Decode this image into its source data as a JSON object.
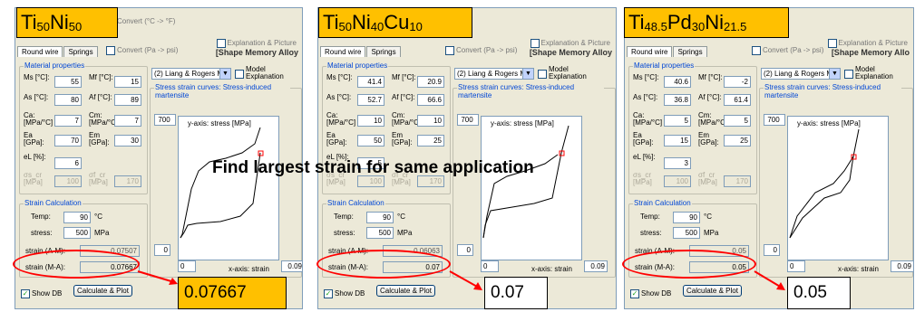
{
  "overlay_text": "Find largest strain for same application",
  "panels": [
    {
      "title_base": "Ti",
      "title_parts": [
        [
          "Ti",
          "50"
        ],
        [
          "Ni",
          "50"
        ]
      ],
      "convert1": "Convert (°C -> °F)",
      "convert2": "Convert (Pa -> psi)",
      "explain1": "Explanation & Picture",
      "explain2": "[Shape Memory Alloy",
      "tab_round": "Round wire",
      "tab_springs": "Springs",
      "mat_label": "Material properties",
      "ms_label": "Ms [°C]:",
      "ms": "55",
      "mf_label": "Mf [°C]:",
      "mf": "15",
      "as_label": "As [°C]:",
      "as": "80",
      "af_label": "Af [°C]:",
      "af": "89",
      "ca_label": "Ca:\n[MPa/°C]",
      "ca": "7",
      "cm_label": "Cm:\n[MPa/°C]",
      "cm": "7",
      "ea_label": "Ea\n[GPa]:",
      "ea": "70",
      "em_label": "Em\n[GPa]:",
      "em": "30",
      "el_label": "eL [%]:",
      "el": "6",
      "csa_label": "σs_cr\n[MPa]",
      "csa": "100",
      "cfa_label": "σf_cr\n[MPa]",
      "cfa": "170",
      "model": "(2) Liang & Rogers Mo",
      "model_expl": "Model\nExplanation",
      "curve_label": "Stress strain curves: Stress-induced martensite",
      "ymax": "700",
      "ylabel": "y-axis: stress [MPa]",
      "ymin": "0",
      "xmin": "0",
      "xmax": "0.09",
      "xlabel": "x-axis: strain",
      "strain_calc": "Strain Calculation",
      "temp_label": "Temp:",
      "temp": "90",
      "temp_unit": "°C",
      "stress_label": "stress:",
      "stress": "500",
      "stress_unit": "MPa",
      "am_label": "strain (A-M):",
      "am": "0.07507",
      "ma_label": "strain (M-A):",
      "ma": "0.07667",
      "showdb": "Show DB",
      "calc": "Calculate & Plot",
      "result": "0.07667"
    },
    {
      "title_parts": [
        [
          "Ti",
          "50"
        ],
        [
          "Ni",
          "40"
        ],
        [
          "Cu",
          "10"
        ]
      ],
      "convert2": "Convert (Pa -> psi)",
      "explain1": "Explanation & Picture",
      "explain2": "[Shape Memory Alloy",
      "tab_round": "Round wire",
      "tab_springs": "Springs",
      "mat_label": "Material properties",
      "ms_label": "Ms [°C]:",
      "ms": "41.4",
      "mf_label": "Mf [°C]:",
      "mf": "20.9",
      "as_label": "As [°C]:",
      "as": "52.7",
      "af_label": "Af [°C]:",
      "af": "66.6",
      "ca_label": "Ca:\n[MPa/°C]",
      "ca": "10",
      "cm_label": "Cm:\n[MPa/°C]",
      "cm": "10",
      "ea_label": "Ea\n[GPa]:",
      "ea": "50",
      "em_label": "Em\n[GPa]:",
      "em": "25",
      "el_label": "eL [%]:",
      "el": "5",
      "csa_label": "σs_cr\n[MPa]",
      "csa": "100",
      "cfa_label": "σf_cr\n[MPa]",
      "cfa": "170",
      "model": "(2) Liang & Rogers Mo",
      "model_expl": "Model\nExplanation",
      "curve_label": "Stress strain curves: Stress-induced martensite",
      "ymax": "700",
      "ylabel": "y-axis: stress [MPa]",
      "ymin": "0",
      "xmin": "0",
      "xmax": "0.09",
      "xlabel": "x-axis: strain",
      "strain_calc": "Strain Calculation",
      "temp_label": "Temp:",
      "temp": "90",
      "temp_unit": "°C",
      "stress_label": "stress:",
      "stress": "500",
      "stress_unit": "MPa",
      "am_label": "strain (A-M):",
      "am": "0.06063",
      "ma_label": "strain (M-A):",
      "ma": "0.07",
      "showdb": "Show DB",
      "calc": "Calculate & Plot",
      "result": "0.07"
    },
    {
      "title_parts": [
        [
          "Ti",
          "48.5"
        ],
        [
          "Pd",
          "30"
        ],
        [
          "Ni",
          "21.5"
        ]
      ],
      "convert2": "Convert (Pa -> psi)",
      "explain1": "Explanation & Picture",
      "explain2": "[Shape Memory Allo",
      "tab_round": "Round wire",
      "tab_springs": "Springs",
      "mat_label": "Material properties",
      "ms_label": "Ms [°C]:",
      "ms": "40.6",
      "mf_label": "Mf [°C]:",
      "mf": "-2",
      "as_label": "As [°C]:",
      "as": "36.8",
      "af_label": "Af [°C]:",
      "af": "61.4",
      "ca_label": "Ca:\n[MPa/°C]",
      "ca": "5",
      "cm_label": "Cm:\n[MPa/°C]",
      "cm": "5",
      "ea_label": "Ea\n[GPa]:",
      "ea": "15",
      "em_label": "Em\n[GPa]:",
      "em": "25",
      "el_label": "eL [%]:",
      "el": "3",
      "csa_label": "σs_cr\n[MPa]",
      "csa": "100",
      "cfa_label": "σf_cr\n[MPa]",
      "cfa": "170",
      "model": "(2) Liang & Rogers Mo",
      "model_expl": "Model\nExplanation",
      "curve_label": "Stress strain curves: Stress-induced martensite",
      "ymax": "700",
      "ylabel": "y-axis: stress [MPa]",
      "ymin": "0",
      "xmin": "0",
      "xmax": "0.09",
      "xlabel": "x-axis: strain",
      "strain_calc": "Strain Calculation",
      "temp_label": "Temp:",
      "temp": "90",
      "temp_unit": "°C",
      "stress_label": "stress:",
      "stress": "500",
      "stress_unit": "MPa",
      "am_label": "strain (A-M):",
      "am": "0.05",
      "ma_label": "strain (M-A):",
      "ma": "0.05",
      "showdb": "Show DB",
      "calc": "Calculate & Plot",
      "result": "0.05"
    }
  ],
  "colors": {
    "highlight": "#ffc000",
    "ellipse": "#ff0000",
    "curve": "#000000",
    "marker": "#ff0000"
  }
}
